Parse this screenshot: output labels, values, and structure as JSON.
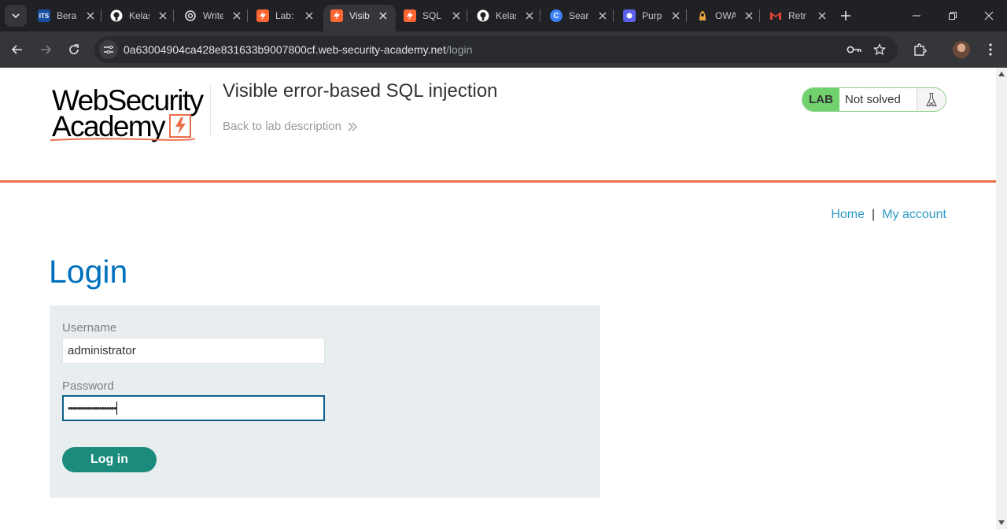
{
  "browser": {
    "tabs": [
      {
        "title": "Berand",
        "favicon": "ITS",
        "favicon_color": "#1a4fa0"
      },
      {
        "title": "Kelas",
        "favicon": "github-icon",
        "favicon_color": "#ffffff"
      },
      {
        "title": "Write",
        "favicon": "openai-icon",
        "favicon_color": "#ffffff"
      },
      {
        "title": "Lab:",
        "favicon": "portswigger-icon",
        "favicon_color": "#ff6633"
      },
      {
        "title": "Visible",
        "favicon": "portswigger-icon",
        "favicon_color": "#ff6633",
        "active": true
      },
      {
        "title": "SQL",
        "favicon": "portswigger-icon",
        "favicon_color": "#ff6633"
      },
      {
        "title": "Kelas",
        "favicon": "github-icon",
        "favicon_color": "#ffffff"
      },
      {
        "title": "Search",
        "favicon": "c-icon",
        "favicon_color": "#3b82f6"
      },
      {
        "title": "Purple",
        "favicon": "purple-icon",
        "favicon_color": "#5b5fe9"
      },
      {
        "title": "OWASP",
        "favicon": "owasp-icon",
        "favicon_color": "#e7a33e"
      },
      {
        "title": "Retr",
        "favicon": "gmail-icon",
        "favicon_color": "#ea4335"
      }
    ],
    "url_host": "0a63004904ca428e831633b9007800cf.web-security-academy.net",
    "url_path": "/login"
  },
  "header": {
    "logo_line1": "WebSecurity",
    "logo_line2": "Academy",
    "lab_title": "Visible error-based SQL injection",
    "back_link": "Back to lab description",
    "badge_lab": "LAB",
    "badge_status": "Not solved"
  },
  "nav": {
    "home": "Home",
    "separator": "|",
    "my_account": "My account"
  },
  "login": {
    "heading": "Login",
    "username_label": "Username",
    "username_value": "administrator",
    "password_label": "Password",
    "password_value": "••••••••••••••••••••",
    "submit_label": "Log in"
  },
  "colors": {
    "accent_orange": "#e96f4a",
    "link_blue": "#2e9ac4",
    "heading_blue": "#0071bc",
    "button_green": "#1b8b7d",
    "badge_green": "#70d16d"
  }
}
